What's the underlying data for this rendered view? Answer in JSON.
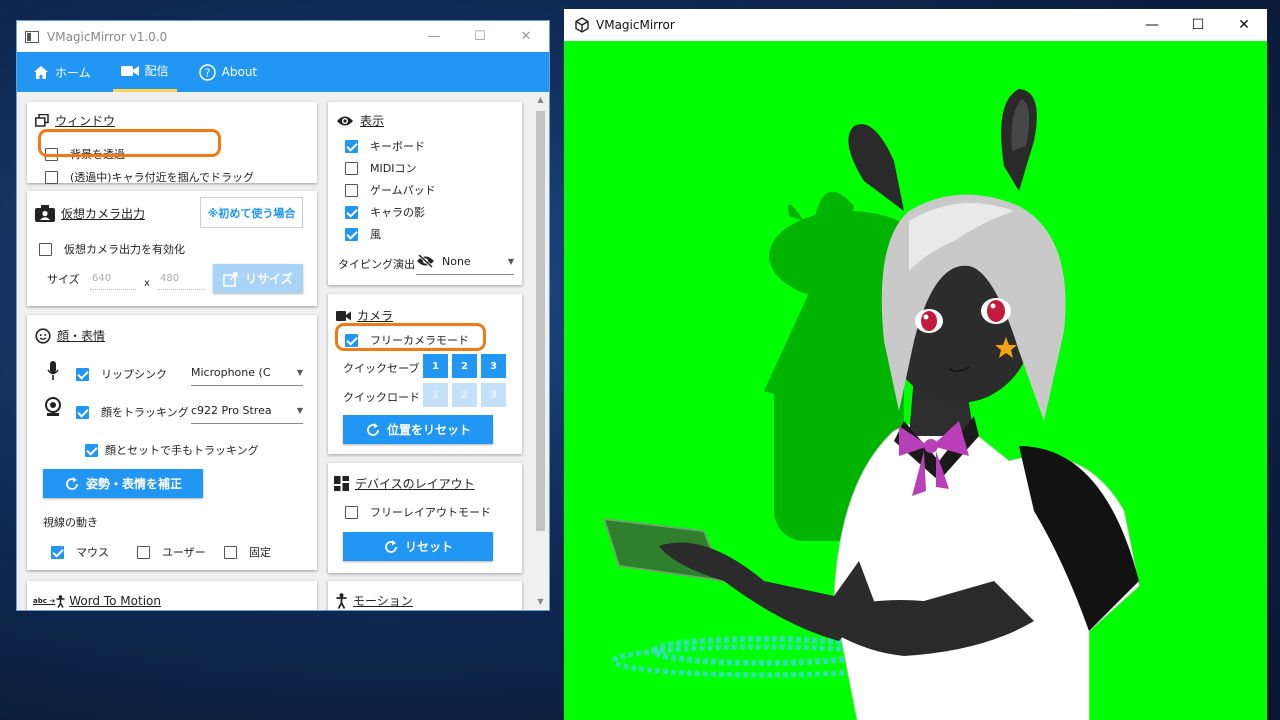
{
  "settings_window": {
    "title": "VMagicMirror v1.0.0",
    "controls": {
      "minimize": "—",
      "maximize": "☐",
      "close": "✕"
    }
  },
  "tabs": [
    {
      "label": "ホーム",
      "icon": "home-icon",
      "active": false
    },
    {
      "label": "配信",
      "icon": "video-camera-icon",
      "active": true
    },
    {
      "label": "About",
      "icon": "help-circle-icon",
      "active": false
    }
  ],
  "window_section": {
    "title": "ウィンドウ",
    "transparent_bg": {
      "label": "背景を透過",
      "checked": false
    },
    "drag_near_char": {
      "label": "(透過中)キャラ付近を掴んでドラッグ",
      "checked": false
    }
  },
  "virtual_cam": {
    "title": "仮想カメラ出力",
    "first_time_button": "※初めて使う場合",
    "enable": {
      "label": "仮想カメラ出力を有効化",
      "checked": false
    },
    "size_label": "サイズ",
    "width": "640",
    "x_sep": "x",
    "height": "480",
    "resize_button": "リサイズ"
  },
  "face": {
    "title": "顔・表情",
    "lipsync": {
      "label": "リップシンク",
      "checked": true,
      "device": "Microphone (C"
    },
    "face_tracking": {
      "label": "顔をトラッキング",
      "checked": true,
      "device": "c922 Pro Strea"
    },
    "hand_tracking": {
      "label": "顔とセットで手もトラッキング",
      "checked": true
    },
    "calibrate_button": "姿勢・表情を補正",
    "gaze_label": "視線の動き",
    "gaze_options": [
      {
        "label": "マウス",
        "checked": true
      },
      {
        "label": "ユーザー",
        "checked": false
      },
      {
        "label": "固定",
        "checked": false
      }
    ]
  },
  "word_to_motion": {
    "title": "Word To Motion",
    "icon_text": "abc ➔"
  },
  "display": {
    "title": "表示",
    "options": [
      {
        "label": "キーボード",
        "checked": true
      },
      {
        "label": "MIDIコン",
        "checked": false
      },
      {
        "label": "ゲームパッド",
        "checked": false
      },
      {
        "label": "キャラの影",
        "checked": true
      },
      {
        "label": "風",
        "checked": true
      }
    ],
    "typing_effect_label": "タイピング演出",
    "typing_effect_value": "None"
  },
  "camera": {
    "title": "カメラ",
    "free_camera": {
      "label": "フリーカメラモード",
      "checked": true
    },
    "quick_save_label": "クイックセーブ",
    "quick_load_label": "クイックロード",
    "slots": [
      "1",
      "2",
      "3"
    ],
    "reset_button": "位置をリセット"
  },
  "device_layout": {
    "title": "デバイスのレイアウト",
    "free_layout": {
      "label": "フリーレイアウトモード",
      "checked": false
    },
    "reset_button": "リセット"
  },
  "motion": {
    "title": "モーション"
  },
  "viewer_window": {
    "title": "VMagicMirror",
    "controls": {
      "minimize": "—",
      "maximize": "☐",
      "close": "✕"
    }
  },
  "colors": {
    "accent": "#2196f3",
    "highlight": "#f07a16",
    "chroma_background": "#00ff00"
  }
}
